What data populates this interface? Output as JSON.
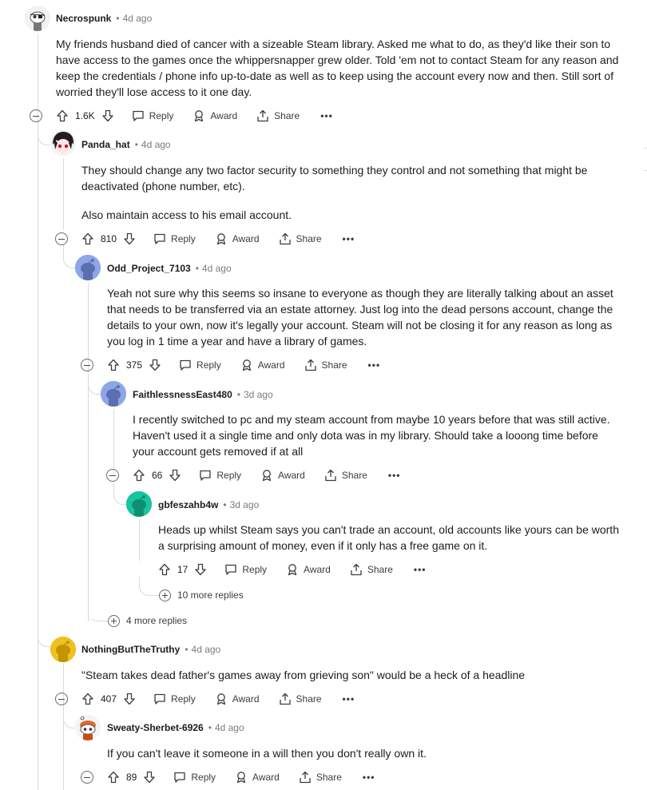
{
  "comments": [
    {
      "author": "Necrospunk",
      "time": "4d ago",
      "avatar": "snoo-avatar-eyepatch",
      "body": [
        "My friends husband died of cancer with a sizeable Steam library. Asked me what to do, as they'd like their son to have access to the games once the whippersnapper grew older. Told 'em not to contact Steam for any reason and keep the credentials / phone info up-to-date as well as to keep using the account every now and then. Still sort of worried they'll lose access to it one day."
      ],
      "votes": "1.6K"
    },
    {
      "author": "Panda_hat",
      "time": "4d ago",
      "avatar": "anime-avatar",
      "body": [
        "They should change any two factor security to something they control and not something that might be deactivated (phone number, etc).",
        "Also maintain access to his email account."
      ],
      "votes": "810"
    },
    {
      "author": "Odd_Project_7103",
      "time": "4d ago",
      "avatar": "snoo-avatar-default",
      "body": [
        "Yeah not sure why this seems so insane to everyone as though they are literally talking about an asset that needs to be transferred via an estate attorney. Just log into the dead persons account, change the details to your own, now it's legally your account. Steam will not be closing it for any reason as long as you log in 1 time a year and have a library of games."
      ],
      "votes": "375"
    },
    {
      "author": "FaithlessnessEast480",
      "time": "3d ago",
      "avatar": "snoo-avatar-default",
      "body": [
        "I recently switched to pc and my steam account from maybe 10 years before that was still active. Haven't used it a single time and only dota was in my library. Should take a looong time before your account gets removed if at all"
      ],
      "votes": "66"
    },
    {
      "author": "gbfeszahb4w",
      "time": "3d ago",
      "avatar": "snoo-avatar-teal",
      "body": [
        "Heads up whilst Steam says you can't trade an account, old accounts like yours can be worth a surprising amount of money, even if it only has a free game on it."
      ],
      "votes": "17"
    },
    {
      "author": "NothingButTheTruthy",
      "time": "4d ago",
      "avatar": "snoo-avatar-yellow",
      "body": [
        "\"Steam takes dead father's games away from grieving son\" would be a heck of a headline"
      ],
      "votes": "407"
    },
    {
      "author": "Sweaty-Sherbet-6926",
      "time": "4d ago",
      "avatar": "snoo-avatar-orange",
      "body": [
        "If you can't leave it someone in a will then you don't really own it."
      ],
      "votes": "89"
    }
  ],
  "actions": {
    "reply": "Reply",
    "award": "Award",
    "share": "Share",
    "more": "•••"
  },
  "more_replies": [
    {
      "label": "10 more replies"
    },
    {
      "label": "4 more replies"
    }
  ],
  "colors": {
    "thread_line": "#d7dadc",
    "meta_gray": "#7c7c7c",
    "snoo_blue": "#8fa6e6",
    "snoo_teal": "#19c4a0",
    "snoo_yellow": "#f0c020"
  }
}
